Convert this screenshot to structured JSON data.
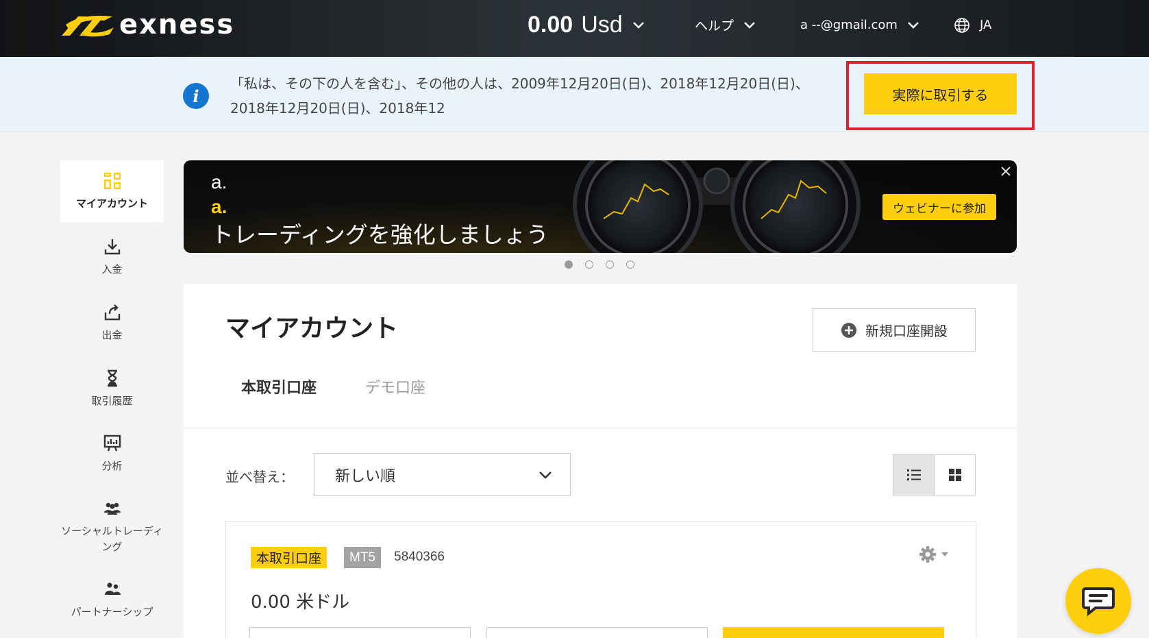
{
  "header": {
    "brand": "exness",
    "balance_amount": "0.00",
    "balance_currency": "Usd",
    "help_label": "ヘルプ",
    "email": "a --@gmail.com",
    "language": "JA"
  },
  "notice": {
    "text": "「私は、その下の人を含む」、その他の人は、2009年12月20日(日)、2018年12月20日(日)、2018年12月20日(日)、2018年12",
    "trade_button_label": "実際に取引する"
  },
  "sidebar": {
    "items": [
      {
        "label": "マイアカウント",
        "icon": "dashboard-icon"
      },
      {
        "label": "入金",
        "icon": "download-icon"
      },
      {
        "label": "出金",
        "icon": "upload-icon"
      },
      {
        "label": "取引履歴",
        "icon": "hourglass-icon"
      },
      {
        "label": "分析",
        "icon": "analytics-icon"
      },
      {
        "label": "ソーシャルトレーディング",
        "icon": "group-icon"
      },
      {
        "label": "パートナーシップ",
        "icon": "partners-icon"
      }
    ]
  },
  "banner": {
    "line1": "a.",
    "line2": "a.",
    "title": "トレーディングを強化しましょう",
    "cta_label": "ウェビナーに参加",
    "slide_count": 4,
    "active_slide": 1
  },
  "main": {
    "title": "マイアカウント",
    "new_account_label": "新規口座開設",
    "tabs": [
      {
        "label": "本取引口座",
        "active": true
      },
      {
        "label": "デモ口座",
        "active": false
      }
    ],
    "sort_label": "並べ替え：",
    "sort_value": "新しい順",
    "view_mode": "list"
  },
  "account": {
    "type_tag": "本取引口座",
    "platform_tag": "MT5",
    "number": "5840366",
    "balance": "0.00 米ドル"
  },
  "colors": {
    "accent": "#ffcf0f",
    "highlight_border": "#e0202a",
    "info_blue": "#1476d0"
  }
}
